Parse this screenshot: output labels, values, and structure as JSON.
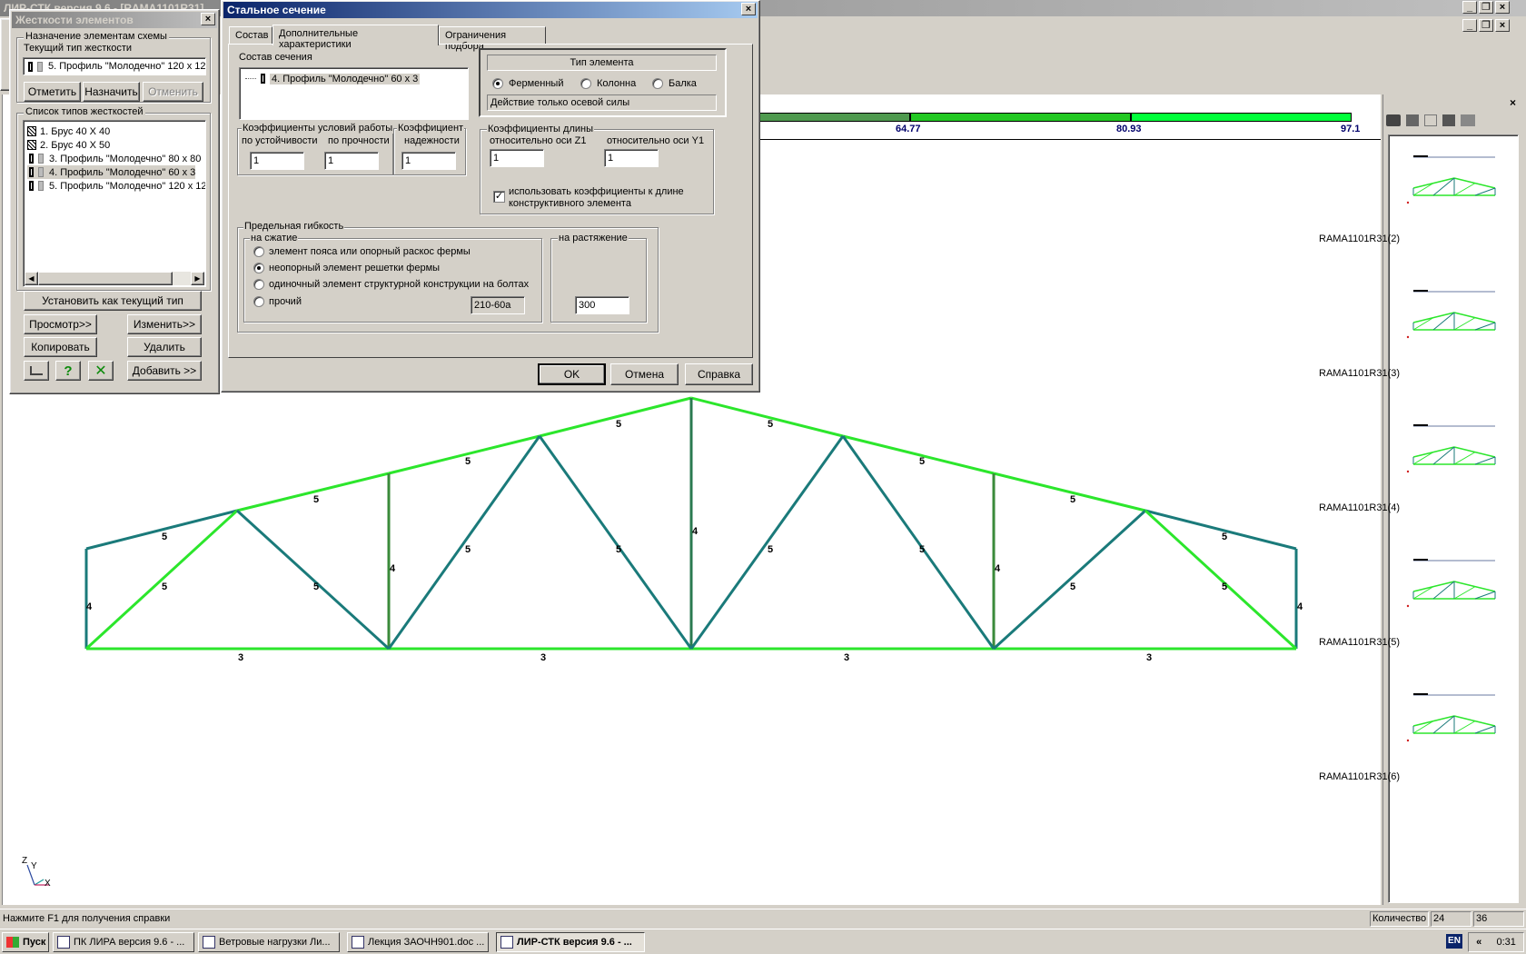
{
  "app": {
    "title": "ЛИР-СТК версия 9.6 - [RAMA1101R31]",
    "status": "Нажмите F1 для получения справки",
    "status_count_label": "Количество",
    "status_val1": "24",
    "status_val2": "36"
  },
  "scale": {
    "values": [
      "64.77",
      "80.93",
      "97.1"
    ],
    "colors": [
      "#4f9a4f",
      "#22c822",
      "#00ff3a"
    ]
  },
  "stiff_window": {
    "title": "Жесткости элементов",
    "assign_group": "Назначение элементам схемы",
    "current_type_label": "Текущий тип жесткости",
    "current_type_value": "5. Профиль \"Молодечно\" 120 x 12",
    "btn_mark": "Отметить",
    "btn_assign": "Назначить",
    "btn_cancel": "Отменить",
    "list_group": "Список типов жесткостей",
    "items": [
      {
        "label": "1. Брус 40 X 40",
        "icon": "hatch"
      },
      {
        "label": "2. Брус 40 X 50",
        "icon": "hatch"
      },
      {
        "label": "3. Профиль \"Молодечно\" 80 x 80",
        "icon": "prof"
      },
      {
        "label": "4. Профиль \"Молодечно\" 60 x 3",
        "icon": "prof"
      },
      {
        "label": "5. Профиль \"Молодечно\" 120 x 12",
        "icon": "prof"
      }
    ],
    "btn_set_current": "Установить как текущий тип",
    "btn_view": "Просмотр>>",
    "btn_edit": "Изменить>>",
    "btn_copy": "Копировать",
    "btn_delete": "Удалить",
    "btn_add": "Добавить >>"
  },
  "steel_dialog": {
    "title": "Стальное сечение",
    "tabs": [
      "Состав",
      "Дополнительные характеристики",
      "Ограничения подбора"
    ],
    "section_group": "Состав сечения",
    "section_item": "4. Профиль \"Молодечно\" 60 x 3",
    "element_type_title": "Тип элемента",
    "type_truss": "Ферменный",
    "type_column": "Колонна",
    "type_beam": "Балка",
    "axial_only": "Действие только осевой силы",
    "coef_work_group": "Коэффициенты условий работы",
    "by_stability": "по устойчивости",
    "by_strength": "по прочности",
    "coef_reliability_1": "Коэффициент",
    "coef_reliability_2": "надежности",
    "val_stability": "1",
    "val_strength": "1",
    "val_reliability": "1",
    "length_group": "Коэффициенты длины",
    "axis_z1": "относительно оси Z1",
    "axis_y1": "относительно оси Y1",
    "val_z1": "1",
    "val_y1": "1",
    "use_coef_1": "использовать коэффициенты к длине",
    "use_coef_2": "конструктивного элемента",
    "slender_group": "Предельная гибкость",
    "compression": "на сжатие",
    "tension": "на растяжение",
    "opt1": "элемент пояса или опорный раскос фермы",
    "opt2": "неопорный элемент решетки фермы",
    "opt3": "одиночный элемент структурной конструкции на болтах",
    "opt4": "прочий",
    "opt4_value": "210-60a",
    "tension_value": "300",
    "btn_ok": "OK",
    "btn_cancel": "Отмена",
    "btn_help": "Справка"
  },
  "truss": {
    "labels": {
      "top": [
        "5",
        "5",
        "5",
        "5",
        "5",
        "5",
        "5",
        "5"
      ],
      "bottom": [
        "3",
        "3",
        "3",
        "3"
      ],
      "diag": [
        "5",
        "5",
        "5",
        "5",
        "5",
        "5",
        "5",
        "5"
      ],
      "vert": [
        "4",
        "4",
        "4",
        "4",
        "4"
      ]
    }
  },
  "axes": {
    "z": "Z",
    "y": "Y",
    "x": "X"
  },
  "thumbnails": [
    "RAMA1101R31(2)",
    "RAMA1101R31(3)",
    "RAMA1101R31(4)",
    "RAMA1101R31(5)",
    "RAMA1101R31(6)"
  ],
  "taskbar": {
    "start": "Пуск",
    "tasks": [
      "ПК ЛИРА  версия 9.6 - ...",
      "Ветровые нагрузки Ли...",
      "Лекция ЗАОЧН901.doc ...",
      "ЛИР-СТК версия 9.6 - ..."
    ],
    "lang": "EN",
    "arrows": "«",
    "clock": "0:31"
  }
}
